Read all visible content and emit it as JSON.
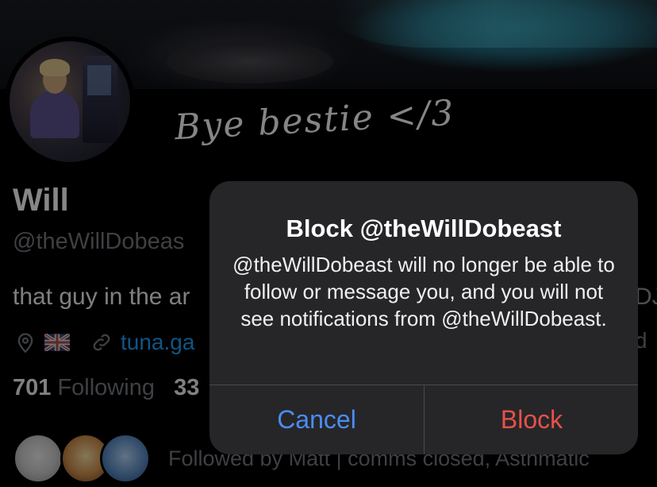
{
  "handwriting_caption": "Bye bestie </3",
  "profile": {
    "display_name": "Will",
    "handle": "@theWillDobeas",
    "bio": "that guy in the ar",
    "bio_tail": "DJ",
    "location_icon": "map-pin-icon",
    "flag_icon": "uk-flag-icon",
    "link_icon": "link-icon",
    "link_text": "tuna.ga",
    "meta_tail": "d",
    "following_count": "701",
    "following_label": "Following",
    "followers_count": "33",
    "followed_by_text": "Followed by Matt | comms closed, Asthmatic"
  },
  "alert": {
    "title": "Block @theWillDobeast",
    "message": "@theWillDobeast will no longer be able to follow or message you, and you will not see notifications from @theWillDobeast.",
    "cancel_label": "Cancel",
    "block_label": "Block"
  },
  "colors": {
    "alert_bg": "#262628",
    "cancel": "#4c8cf5",
    "block": "#e8514a",
    "link": "#1d9bf0",
    "muted": "#71767b"
  }
}
